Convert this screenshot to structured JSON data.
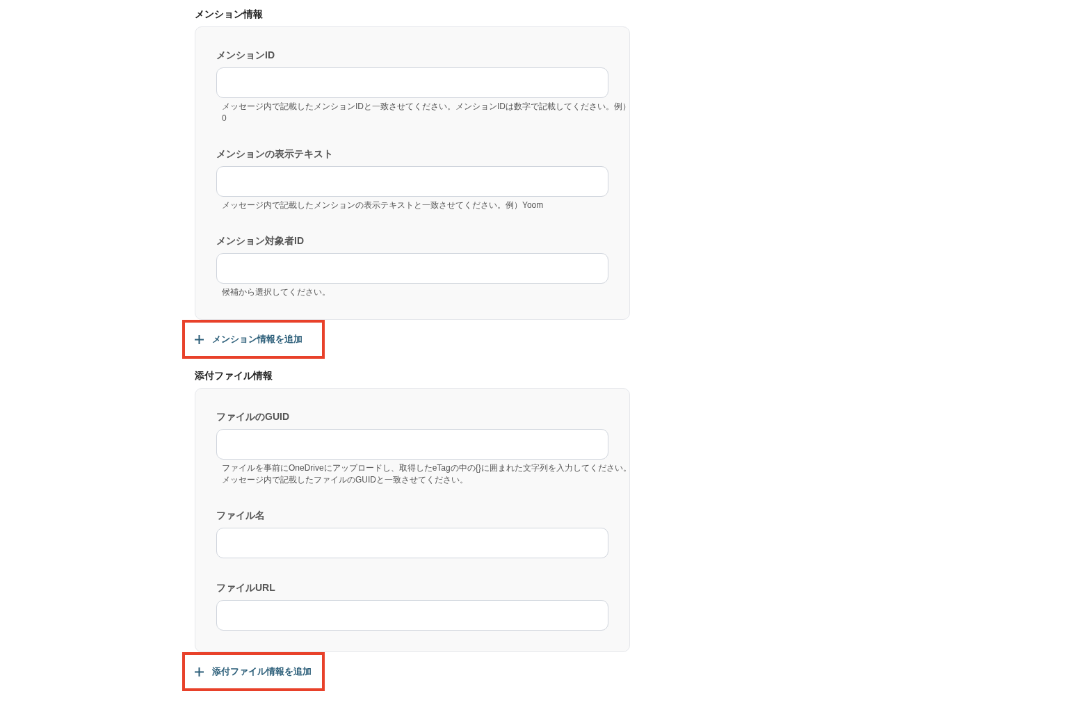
{
  "sections": [
    {
      "title": "メンション情報",
      "fields": [
        {
          "label": "メンションID",
          "hint": "メッセージ内で記載したメンションIDと一致させてください。メンションIDは数字で記載してください。例）0"
        },
        {
          "label": "メンションの表示テキスト",
          "hint": "メッセージ内で記載したメンションの表示テキストと一致させてください。例）Yoom"
        },
        {
          "label": "メンション対象者ID",
          "hint": "候補から選択してください。"
        }
      ],
      "add_button": {
        "label": "メンション情報を追加",
        "highlighted": true
      }
    },
    {
      "title": "添付ファイル情報",
      "fields": [
        {
          "label": "ファイルのGUID",
          "hint": "ファイルを事前にOneDriveにアップロードし、取得したeTagの中の{}に囲まれた文字列を入力してください。メッセージ内で記載したファイルのGUIDと一致させてください。"
        },
        {
          "label": "ファイル名"
        },
        {
          "label": "ファイルURL"
        }
      ],
      "add_button": {
        "label": "添付ファイル情報を追加",
        "highlighted": true
      }
    }
  ]
}
